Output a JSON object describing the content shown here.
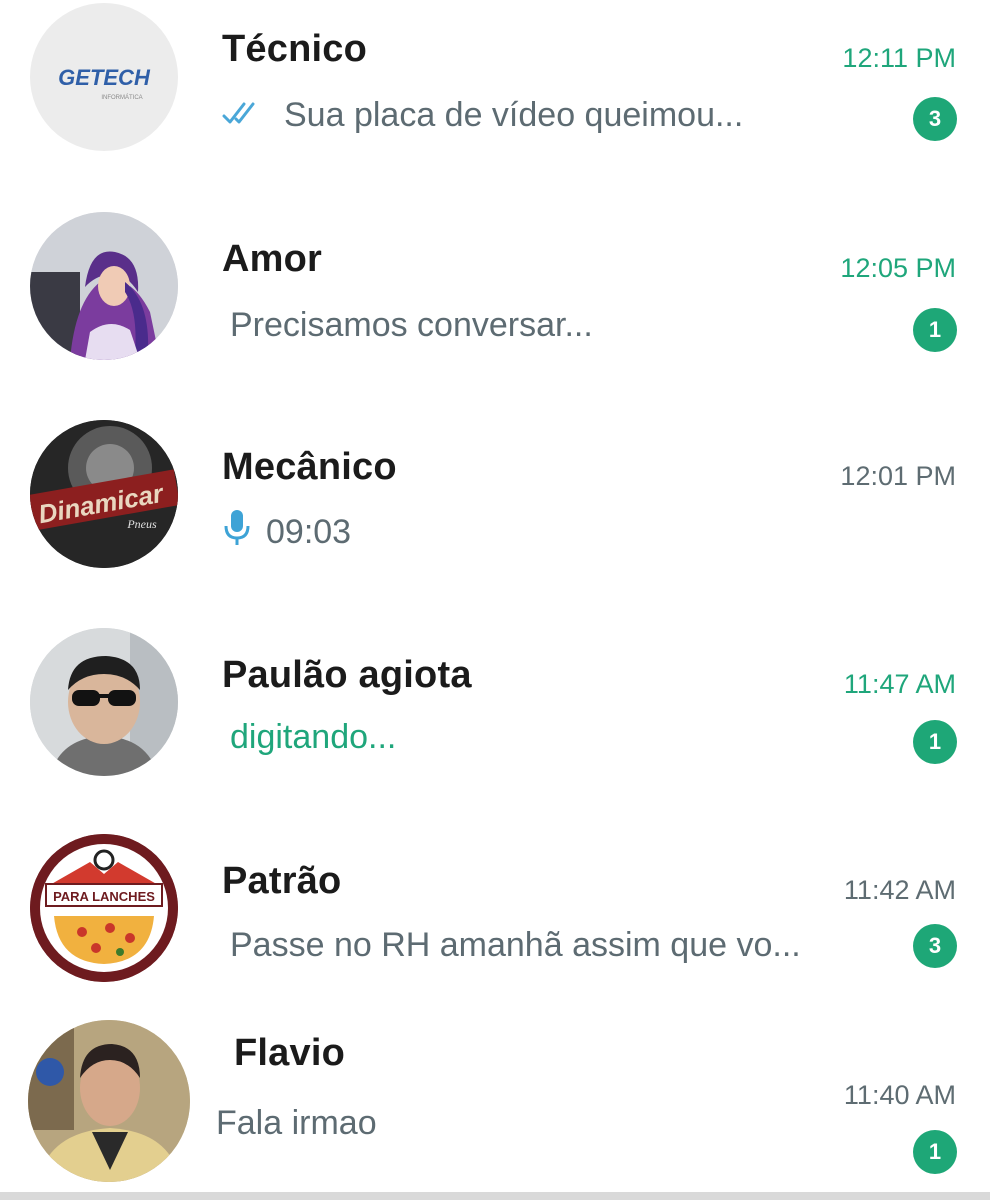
{
  "colors": {
    "accent": "#1ea777",
    "badge_text": "#ffffff",
    "secondary_text": "#5d6b72"
  },
  "chats": [
    {
      "name": "Técnico",
      "time": "12:11 PM",
      "preview": "Sua placa de vídeo queimou...",
      "unread": "3",
      "status_icon": "double-check-icon",
      "avatar_text": "GETECH",
      "avatar_sub": "INFORMÁTICA"
    },
    {
      "name": "Amor",
      "time": "12:05 PM",
      "preview": "Precisamos conversar...",
      "unread": "1"
    },
    {
      "name": "Mecânico",
      "time": "12:01 PM",
      "preview": "09:03",
      "status_icon": "microphone-icon",
      "avatar_text": "Dinamicar",
      "avatar_sub": "Pneus"
    },
    {
      "name": "Paulão agiota",
      "time": "11:47 AM",
      "preview": "digitando...",
      "unread": "1"
    },
    {
      "name": "Patrão",
      "time": "11:42 AM",
      "preview": "Passe no RH amanhã assim que vo...",
      "unread": "3",
      "avatar_text": "PARA LANCHES"
    },
    {
      "name": "Flavio",
      "time": "11:40 AM",
      "preview": "Fala irmao",
      "unread": "1"
    }
  ]
}
